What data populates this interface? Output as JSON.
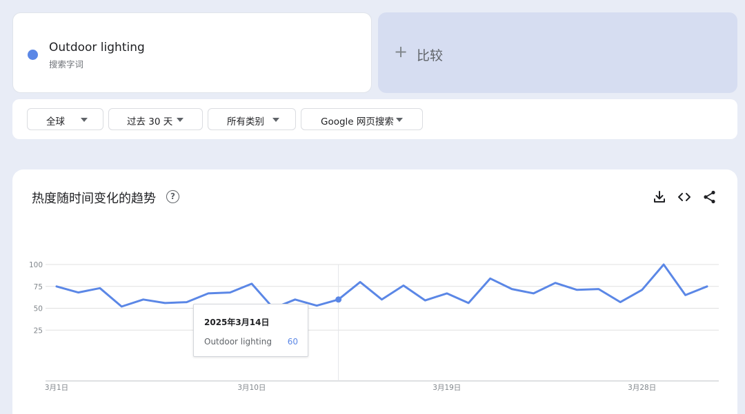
{
  "search_term": {
    "name": "Outdoor lighting",
    "subtitle": "搜索字词",
    "color": "#5b87e6"
  },
  "compare": {
    "plus": "+",
    "label": "比较"
  },
  "filters": {
    "region": "全球",
    "time": "过去 30 天",
    "category": "所有类别",
    "search_type": "Google 网页搜索"
  },
  "chart_section": {
    "title": "热度随时间变化的趋势",
    "help_icon": "?",
    "icons": [
      "download-icon",
      "embed-code-icon",
      "share-icon"
    ]
  },
  "tooltip": {
    "date": "2025年3月14日",
    "series": "Outdoor lighting",
    "value": "60"
  },
  "chart_data": {
    "type": "line",
    "x": [
      "3月1日",
      "3月2日",
      "3月3日",
      "3月4日",
      "3月5日",
      "3月6日",
      "3月7日",
      "3月8日",
      "3月9日",
      "3月10日",
      "3月11日",
      "3月12日",
      "3月13日",
      "3月14日",
      "3月15日",
      "3月16日",
      "3月17日",
      "3月18日",
      "3月19日",
      "3月20日",
      "3月21日",
      "3月22日",
      "3月23日",
      "3月24日",
      "3月25日",
      "3月26日",
      "3月27日",
      "3月28日",
      "3月29日",
      "3月30日",
      "3月31日"
    ],
    "xticks": [
      "3月1日",
      "3月10日",
      "3月19日",
      "3月28日"
    ],
    "yticks": [
      25,
      50,
      75,
      100
    ],
    "ylim": [
      0,
      100
    ],
    "series": [
      {
        "name": "Outdoor lighting",
        "color": "#5b87e6",
        "values": [
          75,
          68,
          73,
          52,
          60,
          56,
          57,
          67,
          68,
          78,
          50,
          60,
          53,
          60,
          80,
          60,
          76,
          59,
          67,
          56,
          84,
          72,
          67,
          79,
          71,
          72,
          57,
          71,
          100,
          65,
          75
        ]
      }
    ],
    "highlight_index": 13,
    "grid": true
  }
}
